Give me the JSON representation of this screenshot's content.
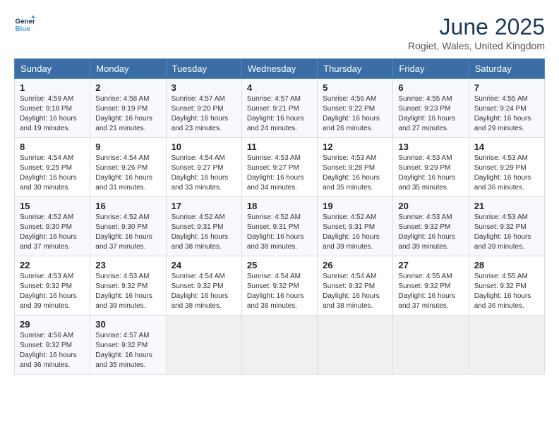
{
  "header": {
    "logo_line1": "General",
    "logo_line2": "Blue",
    "title": "June 2025",
    "location": "Rogiet, Wales, United Kingdom"
  },
  "days_of_week": [
    "Sunday",
    "Monday",
    "Tuesday",
    "Wednesday",
    "Thursday",
    "Friday",
    "Saturday"
  ],
  "weeks": [
    [
      {
        "day": "1",
        "info": "Sunrise: 4:59 AM\nSunset: 9:18 PM\nDaylight: 16 hours\nand 19 minutes."
      },
      {
        "day": "2",
        "info": "Sunrise: 4:58 AM\nSunset: 9:19 PM\nDaylight: 16 hours\nand 21 minutes."
      },
      {
        "day": "3",
        "info": "Sunrise: 4:57 AM\nSunset: 9:20 PM\nDaylight: 16 hours\nand 23 minutes."
      },
      {
        "day": "4",
        "info": "Sunrise: 4:57 AM\nSunset: 9:21 PM\nDaylight: 16 hours\nand 24 minutes."
      },
      {
        "day": "5",
        "info": "Sunrise: 4:56 AM\nSunset: 9:22 PM\nDaylight: 16 hours\nand 26 minutes."
      },
      {
        "day": "6",
        "info": "Sunrise: 4:55 AM\nSunset: 9:23 PM\nDaylight: 16 hours\nand 27 minutes."
      },
      {
        "day": "7",
        "info": "Sunrise: 4:55 AM\nSunset: 9:24 PM\nDaylight: 16 hours\nand 29 minutes."
      }
    ],
    [
      {
        "day": "8",
        "info": "Sunrise: 4:54 AM\nSunset: 9:25 PM\nDaylight: 16 hours\nand 30 minutes."
      },
      {
        "day": "9",
        "info": "Sunrise: 4:54 AM\nSunset: 9:26 PM\nDaylight: 16 hours\nand 31 minutes."
      },
      {
        "day": "10",
        "info": "Sunrise: 4:54 AM\nSunset: 9:27 PM\nDaylight: 16 hours\nand 33 minutes."
      },
      {
        "day": "11",
        "info": "Sunrise: 4:53 AM\nSunset: 9:27 PM\nDaylight: 16 hours\nand 34 minutes."
      },
      {
        "day": "12",
        "info": "Sunrise: 4:53 AM\nSunset: 9:28 PM\nDaylight: 16 hours\nand 35 minutes."
      },
      {
        "day": "13",
        "info": "Sunrise: 4:53 AM\nSunset: 9:29 PM\nDaylight: 16 hours\nand 35 minutes."
      },
      {
        "day": "14",
        "info": "Sunrise: 4:53 AM\nSunset: 9:29 PM\nDaylight: 16 hours\nand 36 minutes."
      }
    ],
    [
      {
        "day": "15",
        "info": "Sunrise: 4:52 AM\nSunset: 9:30 PM\nDaylight: 16 hours\nand 37 minutes."
      },
      {
        "day": "16",
        "info": "Sunrise: 4:52 AM\nSunset: 9:30 PM\nDaylight: 16 hours\nand 37 minutes."
      },
      {
        "day": "17",
        "info": "Sunrise: 4:52 AM\nSunset: 9:31 PM\nDaylight: 16 hours\nand 38 minutes."
      },
      {
        "day": "18",
        "info": "Sunrise: 4:52 AM\nSunset: 9:31 PM\nDaylight: 16 hours\nand 38 minutes."
      },
      {
        "day": "19",
        "info": "Sunrise: 4:52 AM\nSunset: 9:31 PM\nDaylight: 16 hours\nand 39 minutes."
      },
      {
        "day": "20",
        "info": "Sunrise: 4:53 AM\nSunset: 9:32 PM\nDaylight: 16 hours\nand 39 minutes."
      },
      {
        "day": "21",
        "info": "Sunrise: 4:53 AM\nSunset: 9:32 PM\nDaylight: 16 hours\nand 39 minutes."
      }
    ],
    [
      {
        "day": "22",
        "info": "Sunrise: 4:53 AM\nSunset: 9:32 PM\nDaylight: 16 hours\nand 39 minutes."
      },
      {
        "day": "23",
        "info": "Sunrise: 4:53 AM\nSunset: 9:32 PM\nDaylight: 16 hours\nand 39 minutes."
      },
      {
        "day": "24",
        "info": "Sunrise: 4:54 AM\nSunset: 9:32 PM\nDaylight: 16 hours\nand 38 minutes."
      },
      {
        "day": "25",
        "info": "Sunrise: 4:54 AM\nSunset: 9:32 PM\nDaylight: 16 hours\nand 38 minutes."
      },
      {
        "day": "26",
        "info": "Sunrise: 4:54 AM\nSunset: 9:32 PM\nDaylight: 16 hours\nand 38 minutes."
      },
      {
        "day": "27",
        "info": "Sunrise: 4:55 AM\nSunset: 9:32 PM\nDaylight: 16 hours\nand 37 minutes."
      },
      {
        "day": "28",
        "info": "Sunrise: 4:55 AM\nSunset: 9:32 PM\nDaylight: 16 hours\nand 36 minutes."
      }
    ],
    [
      {
        "day": "29",
        "info": "Sunrise: 4:56 AM\nSunset: 9:32 PM\nDaylight: 16 hours\nand 36 minutes."
      },
      {
        "day": "30",
        "info": "Sunrise: 4:57 AM\nSunset: 9:32 PM\nDaylight: 16 hours\nand 35 minutes."
      },
      {
        "day": "",
        "info": ""
      },
      {
        "day": "",
        "info": ""
      },
      {
        "day": "",
        "info": ""
      },
      {
        "day": "",
        "info": ""
      },
      {
        "day": "",
        "info": ""
      }
    ]
  ]
}
